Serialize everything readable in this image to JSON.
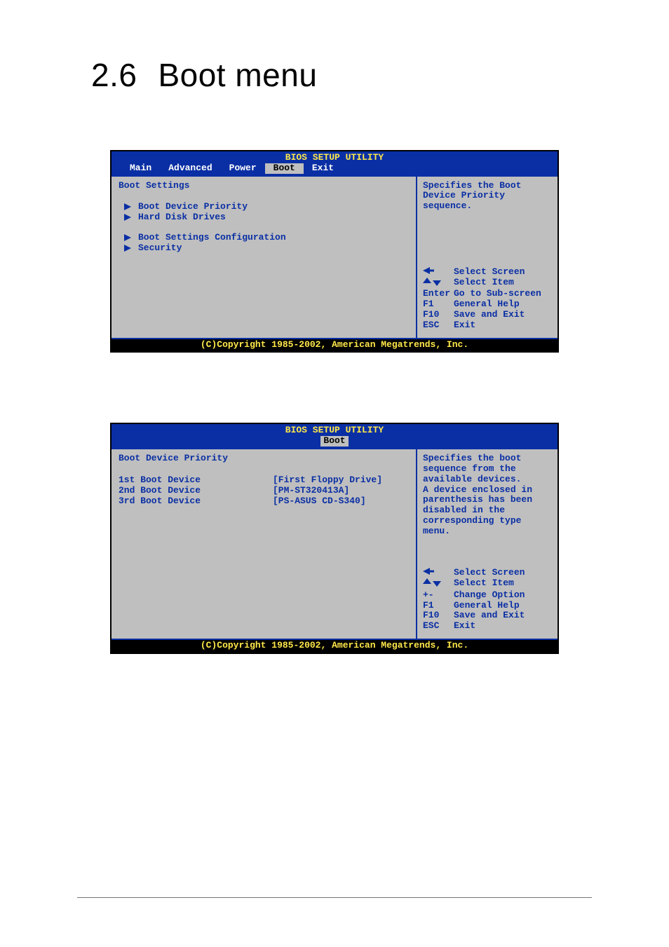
{
  "page": {
    "section_number": "2.6",
    "section_title": "Boot menu"
  },
  "bios1": {
    "title": "BIOS SETUP UTILITY",
    "tabs": {
      "main": "Main",
      "advanced": "Advanced",
      "power": "Power",
      "boot": "Boot",
      "exit": "Exit"
    },
    "heading": "Boot Settings",
    "items": {
      "boot_priority": "Boot Device Priority",
      "hard_drives": "Hard Disk Drives",
      "boot_config": "Boot Settings Configuration",
      "security": "Security"
    },
    "help": {
      "l1": "Specifies the Boot",
      "l2": "Device Priority",
      "l3": "sequence."
    },
    "keys": {
      "select_screen": "Select Screen",
      "select_item": "Select Item",
      "enter_key": "Enter",
      "enter_label": "Go to Sub-screen",
      "f1_key": "F1",
      "f1_label": "General Help",
      "f10_key": "F10",
      "f10_label": "Save and Exit",
      "esc_key": "ESC",
      "esc_label": "Exit"
    },
    "copyright": "(C)Copyright 1985-2002, American Megatrends, Inc."
  },
  "bios2": {
    "title": "BIOS SETUP UTILITY",
    "tab_boot": "Boot",
    "heading": "Boot Device Priority",
    "rows": {
      "r1k": "1st Boot Device",
      "r1v": "[First Floppy Drive]",
      "r2k": "2nd Boot Device",
      "r2v": "[PM-ST320413A]",
      "r3k": "3rd Boot Device",
      "r3v": "[PS-ASUS CD-S340]"
    },
    "help": {
      "l1": "Specifies the boot",
      "l2": "sequence from the",
      "l3": "available devices.",
      "l4": "",
      "l5": "A device enclosed in",
      "l6": "parenthesis has been",
      "l7": "disabled in the",
      "l8": "corresponding type",
      "l9": "menu."
    },
    "keys": {
      "select_screen": "Select Screen",
      "select_item": "Select Item",
      "pm_key": "+-",
      "pm_label": "Change Option",
      "f1_key": "F1",
      "f1_label": "General Help",
      "f10_key": "F10",
      "f10_label": "Save and Exit",
      "esc_key": "ESC",
      "esc_label": "Exit"
    },
    "copyright": "(C)Copyright 1985-2002, American Megatrends, Inc."
  }
}
